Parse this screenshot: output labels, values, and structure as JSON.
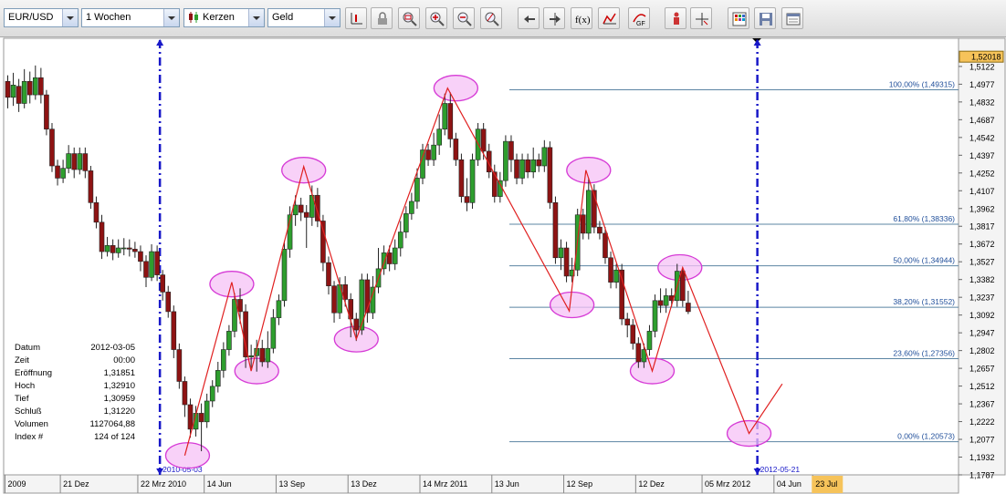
{
  "toolbar": {
    "symbol": "EUR/USD",
    "period": "1 Wochen",
    "chart_type": "Kerzen",
    "price_type": "Geld",
    "buttons": [
      "cursor-line-icon",
      "lock-icon",
      "zoom-fit-icon",
      "zoom-in-icon",
      "zoom-out-icon",
      "zoom-reset-icon",
      "scroll-left-icon",
      "scroll-right-icon",
      "function-icon",
      "indicator-icon",
      "gf-icon",
      "figure-icon",
      "crosshair-icon",
      "grid-icon",
      "save-icon",
      "window-icon"
    ]
  },
  "colors": {
    "up": "#2e9e2e",
    "down": "#8e1313",
    "trend": "#e02020",
    "fib": "#5b84a3",
    "vline": "#1818c8",
    "ellipse_stroke": "#d63bd6",
    "ellipse_fill": "#f6c2f6"
  },
  "info": {
    "rows": [
      {
        "label": "Datum",
        "value": "2012-03-05"
      },
      {
        "label": "Zeit",
        "value": "00:00"
      },
      {
        "label": "Eröffnung",
        "value": "1,31851"
      },
      {
        "label": "Hoch",
        "value": "1,32910"
      },
      {
        "label": "Tief",
        "value": "1,30959"
      },
      {
        "label": "Schluß",
        "value": "1,31220"
      },
      {
        "label": "Volumen",
        "value": "1127064,88"
      },
      {
        "label": "Index #",
        "value": "124 of 124"
      }
    ]
  },
  "chart_data": {
    "type": "candlestick",
    "ylim": [
      1.1787,
      1.5352
    ],
    "y_ticks": [
      "1,5122",
      "1,4977",
      "1,4832",
      "1,4687",
      "1,4542",
      "1,4397",
      "1,4252",
      "1,4107",
      "1,3962",
      "1,3817",
      "1,3672",
      "1,3527",
      "1,3382",
      "1,3237",
      "1,3092",
      "1,2947",
      "1,2802",
      "1,2657",
      "1,2512",
      "1,2367",
      "1,2222",
      "1,2077",
      "1,1932",
      "1,1787"
    ],
    "y_tick_values": [
      1.5122,
      1.4977,
      1.4832,
      1.4687,
      1.4542,
      1.4397,
      1.4252,
      1.4107,
      1.3962,
      1.3817,
      1.3672,
      1.3527,
      1.3382,
      1.3237,
      1.3092,
      1.2947,
      1.2802,
      1.2657,
      1.2512,
      1.2367,
      1.2222,
      1.2077,
      1.1932,
      1.1787
    ],
    "current_price": "1,52018",
    "x_ticks": [
      {
        "label": "2009",
        "i": 0
      },
      {
        "label": "21 Dez",
        "i": 10
      },
      {
        "label": "22 Mrz 2010",
        "i": 24
      },
      {
        "label": "14 Jun",
        "i": 36
      },
      {
        "label": "13 Sep",
        "i": 49
      },
      {
        "label": "13 Dez",
        "i": 62
      },
      {
        "label": "14 Mrz 2011",
        "i": 75
      },
      {
        "label": "13 Jun",
        "i": 88
      },
      {
        "label": "12 Sep",
        "i": 101
      },
      {
        "label": "12 Dez",
        "i": 114
      },
      {
        "label": "05 Mrz 2012",
        "i": 126
      },
      {
        "label": "04 Jun",
        "i": 139
      },
      {
        "label": "23 Jul",
        "i": 146
      }
    ],
    "fib_levels": [
      {
        "label": "100,00% (1,49315)",
        "value": 1.49315
      },
      {
        "label": "61,80% (1,38336)",
        "value": 1.38336
      },
      {
        "label": "50,00% (1,34944)",
        "value": 1.34944
      },
      {
        "label": "38,20% (1,31552)",
        "value": 1.31552
      },
      {
        "label": "23,60% (1,27356)",
        "value": 1.27356
      },
      {
        "label": "0,00% (1,20573)",
        "value": 1.20573
      }
    ],
    "vlines": [
      {
        "label": "2010-05-03",
        "i": 27.5
      },
      {
        "label": "2012-05-21",
        "i": 135.5
      }
    ],
    "trend": [
      {
        "i": 32,
        "v": 1.1945
      },
      {
        "i": 40.5,
        "v": 1.336
      },
      {
        "i": 44,
        "v": 1.2635
      },
      {
        "i": 53.5,
        "v": 1.4305
      },
      {
        "i": 63,
        "v": 1.2895
      },
      {
        "i": 79.5,
        "v": 1.4945
      },
      {
        "i": 101.5,
        "v": 1.3125
      },
      {
        "i": 104.5,
        "v": 1.4275
      },
      {
        "i": 116.5,
        "v": 1.2635
      },
      {
        "i": 122,
        "v": 1.348
      },
      {
        "i": 134,
        "v": 1.2125
      },
      {
        "i": 140,
        "v": 1.253
      }
    ],
    "ellipses": [
      {
        "i": 32.5,
        "v": 1.1945
      },
      {
        "i": 40.5,
        "v": 1.3345
      },
      {
        "i": 45,
        "v": 1.2635
      },
      {
        "i": 53.5,
        "v": 1.4275
      },
      {
        "i": 63,
        "v": 1.2895
      },
      {
        "i": 81,
        "v": 1.4945
      },
      {
        "i": 102,
        "v": 1.3175
      },
      {
        "i": 105,
        "v": 1.4275
      },
      {
        "i": 116.5,
        "v": 1.2635
      },
      {
        "i": 121.5,
        "v": 1.348
      },
      {
        "i": 134,
        "v": 1.2125
      }
    ],
    "candles": [
      [
        1.5,
        1.487,
        1.505,
        1.478
      ],
      [
        1.487,
        1.497,
        1.507,
        1.48
      ],
      [
        1.496,
        1.482,
        1.502,
        1.475
      ],
      [
        1.482,
        1.5,
        1.51,
        1.478
      ],
      [
        1.5,
        1.489,
        1.508,
        1.482
      ],
      [
        1.489,
        1.503,
        1.513,
        1.485
      ],
      [
        1.503,
        1.489,
        1.511,
        1.482
      ],
      [
        1.489,
        1.461,
        1.493,
        1.456
      ],
      [
        1.461,
        1.431,
        1.466,
        1.426
      ],
      [
        1.431,
        1.421,
        1.436,
        1.415
      ],
      [
        1.421,
        1.429,
        1.436,
        1.417
      ],
      [
        1.429,
        1.441,
        1.448,
        1.425
      ],
      [
        1.441,
        1.428,
        1.446,
        1.421
      ],
      [
        1.428,
        1.441,
        1.446,
        1.424
      ],
      [
        1.441,
        1.427,
        1.446,
        1.421
      ],
      [
        1.427,
        1.401,
        1.431,
        1.396
      ],
      [
        1.401,
        1.385,
        1.406,
        1.38
      ],
      [
        1.385,
        1.361,
        1.391,
        1.355
      ],
      [
        1.361,
        1.366,
        1.373,
        1.357
      ],
      [
        1.366,
        1.36,
        1.371,
        1.354
      ],
      [
        1.36,
        1.364,
        1.371,
        1.356
      ],
      [
        1.364,
        1.364,
        1.372,
        1.358
      ],
      [
        1.364,
        1.363,
        1.371,
        1.357
      ],
      [
        1.363,
        1.361,
        1.369,
        1.356
      ],
      [
        1.361,
        1.353,
        1.366,
        1.345
      ],
      [
        1.353,
        1.34,
        1.358,
        1.332
      ],
      [
        1.34,
        1.361,
        1.367,
        1.337
      ],
      [
        1.361,
        1.342,
        1.366,
        1.337
      ],
      [
        1.342,
        1.328,
        1.346,
        1.321
      ],
      [
        1.328,
        1.312,
        1.333,
        1.307
      ],
      [
        1.312,
        1.281,
        1.317,
        1.274
      ],
      [
        1.281,
        1.255,
        1.286,
        1.249
      ],
      [
        1.255,
        1.236,
        1.259,
        1.226
      ],
      [
        1.236,
        1.216,
        1.241,
        1.209
      ],
      [
        1.216,
        1.229,
        1.235,
        1.21
      ],
      [
        1.229,
        1.222,
        1.237,
        1.198
      ],
      [
        1.222,
        1.239,
        1.245,
        1.217
      ],
      [
        1.239,
        1.251,
        1.256,
        1.234
      ],
      [
        1.251,
        1.264,
        1.271,
        1.246
      ],
      [
        1.264,
        1.281,
        1.287,
        1.258
      ],
      [
        1.281,
        1.296,
        1.301,
        1.276
      ],
      [
        1.296,
        1.322,
        1.327,
        1.291
      ],
      [
        1.322,
        1.312,
        1.331,
        1.302
      ],
      [
        1.312,
        1.275,
        1.318,
        1.266
      ],
      [
        1.275,
        1.276,
        1.285,
        1.266
      ],
      [
        1.276,
        1.282,
        1.289,
        1.263
      ],
      [
        1.282,
        1.271,
        1.289,
        1.267
      ],
      [
        1.271,
        1.282,
        1.296,
        1.266
      ],
      [
        1.282,
        1.307,
        1.314,
        1.278
      ],
      [
        1.307,
        1.321,
        1.326,
        1.301
      ],
      [
        1.321,
        1.363,
        1.37,
        1.316
      ],
      [
        1.363,
        1.391,
        1.398,
        1.356
      ],
      [
        1.391,
        1.399,
        1.407,
        1.382
      ],
      [
        1.399,
        1.393,
        1.405,
        1.386
      ],
      [
        1.393,
        1.389,
        1.399,
        1.364
      ],
      [
        1.389,
        1.407,
        1.415,
        1.382
      ],
      [
        1.407,
        1.386,
        1.413,
        1.381
      ],
      [
        1.386,
        1.352,
        1.391,
        1.345
      ],
      [
        1.352,
        1.333,
        1.357,
        1.326
      ],
      [
        1.333,
        1.311,
        1.337,
        1.303
      ],
      [
        1.311,
        1.334,
        1.34,
        1.306
      ],
      [
        1.334,
        1.322,
        1.341,
        1.316
      ],
      [
        1.322,
        1.306,
        1.327,
        1.291
      ],
      [
        1.306,
        1.297,
        1.311,
        1.288
      ],
      [
        1.297,
        1.338,
        1.343,
        1.293
      ],
      [
        1.338,
        1.311,
        1.343,
        1.303
      ],
      [
        1.311,
        1.332,
        1.341,
        1.306
      ],
      [
        1.332,
        1.347,
        1.364,
        1.327
      ],
      [
        1.347,
        1.36,
        1.366,
        1.342
      ],
      [
        1.36,
        1.351,
        1.366,
        1.345
      ],
      [
        1.351,
        1.364,
        1.371,
        1.346
      ],
      [
        1.364,
        1.377,
        1.386,
        1.357
      ],
      [
        1.377,
        1.392,
        1.398,
        1.372
      ],
      [
        1.392,
        1.402,
        1.409,
        1.387
      ],
      [
        1.402,
        1.421,
        1.429,
        1.396
      ],
      [
        1.421,
        1.444,
        1.449,
        1.416
      ],
      [
        1.444,
        1.436,
        1.449,
        1.431
      ],
      [
        1.436,
        1.448,
        1.458,
        1.431
      ],
      [
        1.448,
        1.461,
        1.473,
        1.44
      ],
      [
        1.461,
        1.482,
        1.49,
        1.456
      ],
      [
        1.482,
        1.453,
        1.491,
        1.446
      ],
      [
        1.453,
        1.436,
        1.458,
        1.431
      ],
      [
        1.436,
        1.406,
        1.441,
        1.401
      ],
      [
        1.406,
        1.401,
        1.421,
        1.394
      ],
      [
        1.401,
        1.436,
        1.441,
        1.396
      ],
      [
        1.436,
        1.461,
        1.466,
        1.431
      ],
      [
        1.461,
        1.443,
        1.466,
        1.436
      ],
      [
        1.443,
        1.426,
        1.449,
        1.421
      ],
      [
        1.426,
        1.406,
        1.432,
        1.401
      ],
      [
        1.406,
        1.419,
        1.426,
        1.401
      ],
      [
        1.419,
        1.451,
        1.456,
        1.414
      ],
      [
        1.451,
        1.436,
        1.456,
        1.426
      ],
      [
        1.436,
        1.421,
        1.441,
        1.416
      ],
      [
        1.421,
        1.436,
        1.441,
        1.416
      ],
      [
        1.436,
        1.426,
        1.441,
        1.421
      ],
      [
        1.426,
        1.436,
        1.446,
        1.421
      ],
      [
        1.436,
        1.431,
        1.441,
        1.426
      ],
      [
        1.431,
        1.446,
        1.452,
        1.426
      ],
      [
        1.446,
        1.401,
        1.451,
        1.396
      ],
      [
        1.401,
        1.356,
        1.406,
        1.351
      ],
      [
        1.356,
        1.364,
        1.371,
        1.346
      ],
      [
        1.364,
        1.341,
        1.369,
        1.336
      ],
      [
        1.341,
        1.346,
        1.356,
        1.336
      ],
      [
        1.346,
        1.391,
        1.396,
        1.341
      ],
      [
        1.391,
        1.376,
        1.396,
        1.371
      ],
      [
        1.376,
        1.411,
        1.421,
        1.371
      ],
      [
        1.411,
        1.381,
        1.416,
        1.376
      ],
      [
        1.381,
        1.376,
        1.386,
        1.371
      ],
      [
        1.376,
        1.356,
        1.381,
        1.351
      ],
      [
        1.356,
        1.336,
        1.361,
        1.331
      ],
      [
        1.336,
        1.346,
        1.351,
        1.331
      ],
      [
        1.346,
        1.306,
        1.351,
        1.301
      ],
      [
        1.306,
        1.301,
        1.311,
        1.291
      ],
      [
        1.301,
        1.286,
        1.306,
        1.281
      ],
      [
        1.286,
        1.271,
        1.291,
        1.266
      ],
      [
        1.271,
        1.281,
        1.286,
        1.266
      ],
      [
        1.281,
        1.296,
        1.301,
        1.276
      ],
      [
        1.296,
        1.321,
        1.326,
        1.291
      ],
      [
        1.321,
        1.317,
        1.331,
        1.311
      ],
      [
        1.317,
        1.325,
        1.331,
        1.311
      ],
      [
        1.325,
        1.321,
        1.331,
        1.316
      ],
      [
        1.321,
        1.345,
        1.351,
        1.316
      ],
      [
        1.345,
        1.321,
        1.348,
        1.316
      ],
      [
        1.319,
        1.312,
        1.329,
        1.31
      ]
    ]
  }
}
